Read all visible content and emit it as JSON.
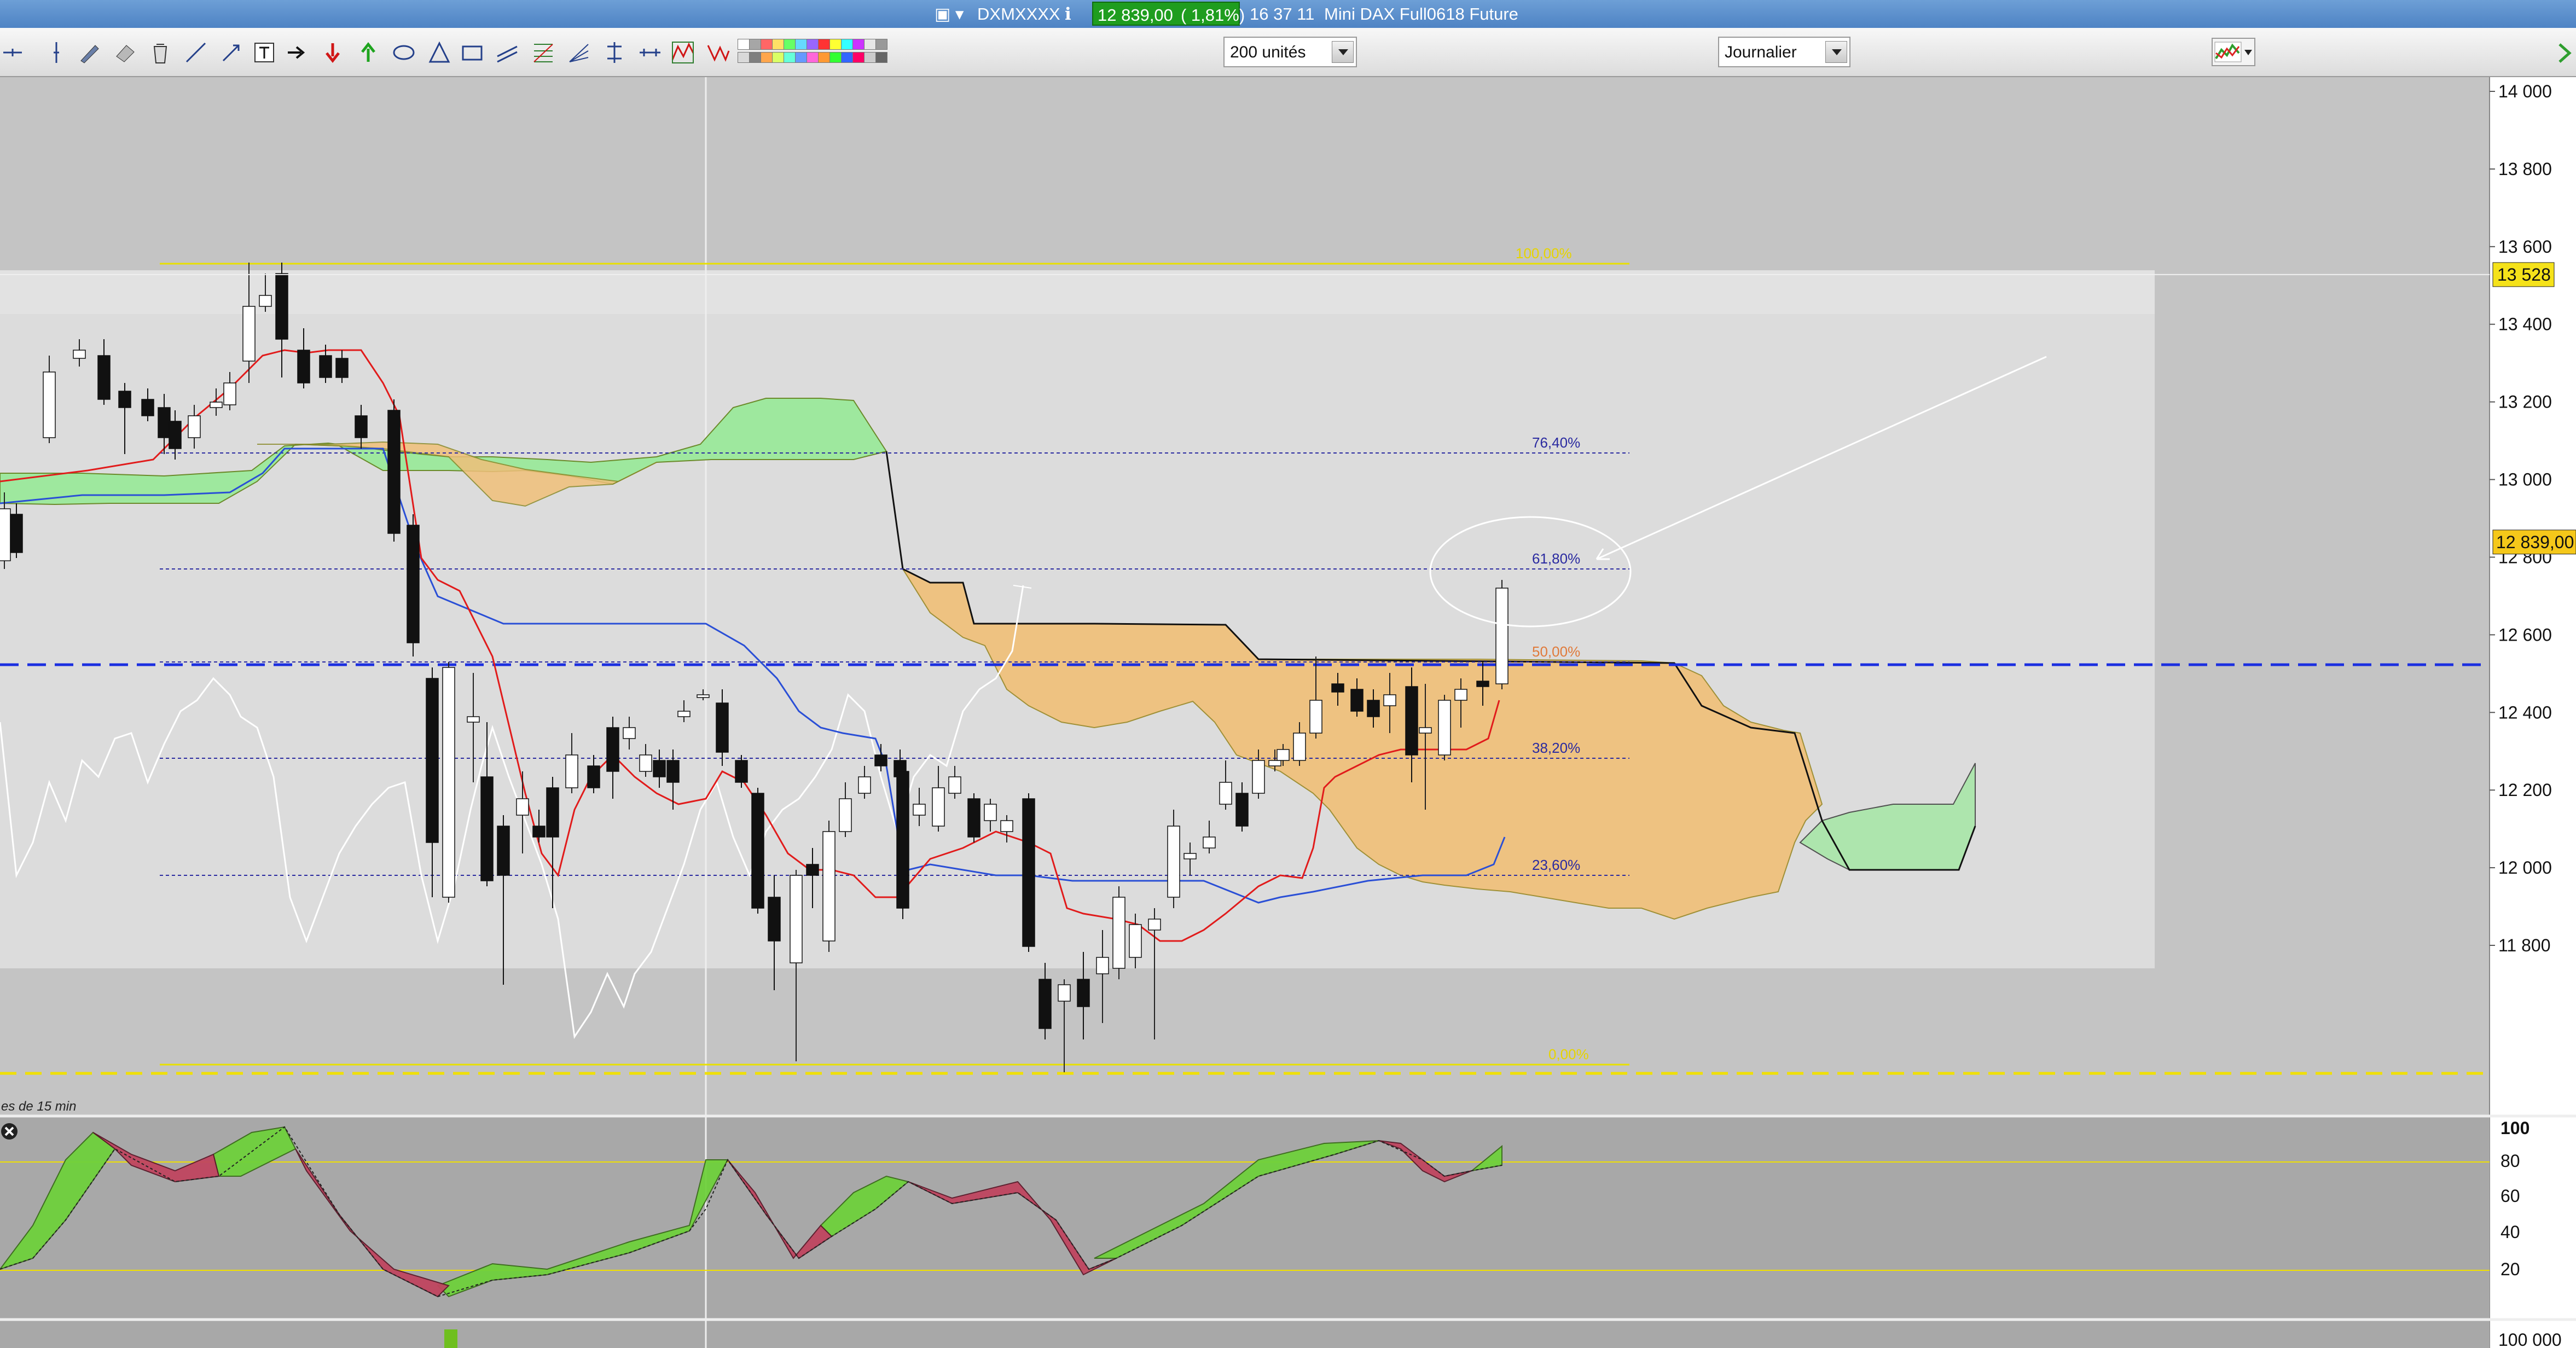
{
  "titlebar": {
    "symbol": "DXMXXXX",
    "price": "12 839,00",
    "change": "( 1,81%)",
    "time": "16 37 11",
    "instrument": "Mini DAX Full0618 Future"
  },
  "toolbar": {
    "units_label": "200 unités",
    "period_label": "Journalier",
    "tools": [
      "crosshair-icon",
      "vertical-line-icon",
      "pencil-icon",
      "eraser-icon",
      "trash-icon",
      "trendline-icon",
      "arrow-line-icon",
      "text-tool-icon",
      "right-arrow-icon",
      "down-arrow-icon",
      "up-arrow-icon",
      "ellipse-icon",
      "triangle-icon",
      "rectangle-icon",
      "channel-icon",
      "fibonacci-icon",
      "fan-icon",
      "measure-icon",
      "cycle-icon",
      "zigzag-icon",
      "pattern-icon"
    ],
    "swatch_colors": [
      "#ffffff",
      "#d9d9d9",
      "#a6a6a6",
      "#7f7f7f",
      "#ff6666",
      "#ffa64d",
      "#ffe066",
      "#d9ff66",
      "#66ff66",
      "#66ffd9",
      "#66d9ff",
      "#6699ff",
      "#9966ff",
      "#ff66d9",
      "#ff3333",
      "#ff9933",
      "#ffff33",
      "#33ff33",
      "#33ffff",
      "#3366ff",
      "#cc33ff",
      "#ff0066",
      "#e6e6e6",
      "#cccccc",
      "#999999",
      "#666666"
    ]
  },
  "price_axis": {
    "labels": [
      "14 000",
      "13 800",
      "13 600",
      "13 400",
      "13 200",
      "13 000",
      "12 800",
      "12 600",
      "12 400",
      "12 200",
      "12 000",
      "11 800"
    ],
    "current_price": "12 839,00",
    "marker_price": "13 528"
  },
  "fibonacci": [
    {
      "label": "100,00%",
      "color": "#e6d400"
    },
    {
      "label": "76,40%",
      "color": "#2a2aa0"
    },
    {
      "label": "61,80%",
      "color": "#2a2aa0"
    },
    {
      "label": "50,00%",
      "color": "#e07a3a"
    },
    {
      "label": "38,20%",
      "color": "#2a2aa0"
    },
    {
      "label": "23,60%",
      "color": "#2a2aa0"
    },
    {
      "label": "0,00%",
      "color": "#e6d400"
    }
  ],
  "timeframe_note": "es de 15 min",
  "oscillator_axis": {
    "labels": [
      "100",
      "80",
      "60",
      "40",
      "20"
    ]
  },
  "volume_axis": {
    "label": "100 000"
  },
  "colors": {
    "bull_candle": "#ffffff",
    "bear_candle": "#111111",
    "tenkan": "#e11b1b",
    "kijun": "#2a4fd6",
    "chikou": "#ffffff",
    "cloud_bull": "#9ee89e",
    "cloud_bear": "#f0c07a",
    "osc_up": "#6fd13c",
    "osc_down": "#c04660"
  }
}
